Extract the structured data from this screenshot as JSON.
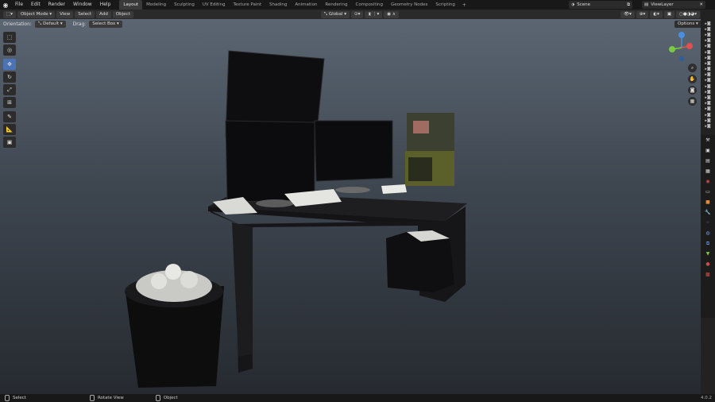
{
  "topbar": {
    "menu": [
      "File",
      "Edit",
      "Render",
      "Window",
      "Help"
    ],
    "workspaces": [
      "Layout",
      "Modeling",
      "Sculpting",
      "UV Editing",
      "Texture Paint",
      "Shading",
      "Animation",
      "Rendering",
      "Compositing",
      "Geometry Nodes",
      "Scripting"
    ],
    "active_workspace": "Layout",
    "scene_label": "Scene",
    "viewlayer_label": "ViewLayer"
  },
  "header": {
    "mode": "Object Mode",
    "view": "View",
    "select": "Select",
    "add": "Add",
    "object": "Object",
    "transform_orientation": "Global"
  },
  "tool_options": {
    "orientation_label": "Orientation:",
    "orientation_value": "Default",
    "drag_label": "Drag:",
    "drag_value": "Select Box",
    "options_label": "Options"
  },
  "statusbar": {
    "select": "Select",
    "rotate": "Rotate View",
    "object": "Object",
    "version": "4.0.2"
  },
  "colors": {
    "accent": "#4a72b5",
    "axis_x": "#e05050",
    "axis_y": "#7ac943",
    "axis_z": "#4a8fe0"
  }
}
